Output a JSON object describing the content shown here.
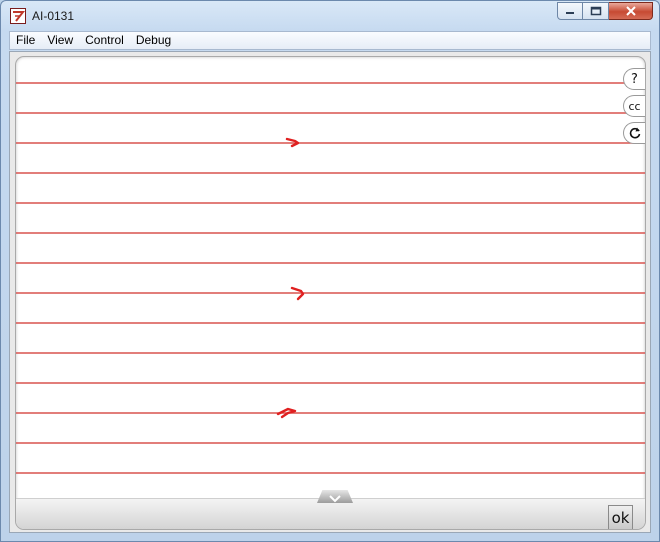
{
  "window": {
    "title": "AI-0131",
    "buttons": [
      "minimize",
      "maximize",
      "close"
    ]
  },
  "menu": {
    "items": [
      {
        "label": "File"
      },
      {
        "label": "View"
      },
      {
        "label": "Control"
      },
      {
        "label": "Debug"
      }
    ]
  },
  "side_buttons": {
    "help": "?",
    "captions": "cc",
    "refresh_icon": "refresh-icon"
  },
  "canvas": {
    "line_color": "#d9534f",
    "mark_color": "#e02020",
    "mark_count": 3
  },
  "footer": {
    "ok_label": "ok",
    "scroll_icon": "chevron-down-icon"
  }
}
